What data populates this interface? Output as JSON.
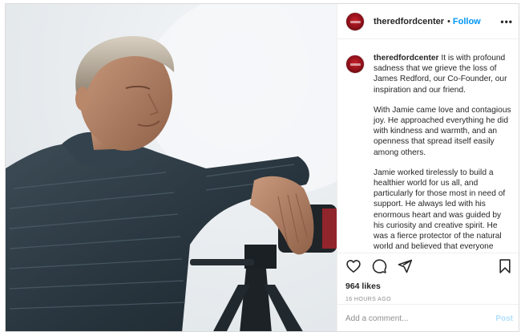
{
  "post": {
    "username": "theredfordcenter",
    "separator": "•",
    "follow_label": "Follow",
    "more_label": "•••",
    "caption": {
      "username": "theredfordcenter",
      "paragraphs": [
        "It is with profound sadness that we grieve the loss of James Redford, our Co-Founder, our inspiration and our friend.",
        "With Jamie came love and contagious joy. He approached everything he did with kindness and warmth, and an openness that spread itself easily among others.",
        "Jamie worked tirelessly to build a healthier world for us all, and particularly for those most in need of support. He always led with his enormous heart and was guided by his curiosity and creative spirit. He was a fierce protector of the natural world and believed that everyone deserved a healthy environment in which they"
      ]
    },
    "likes": "964 likes",
    "timestamp": "16 HOURS AGO",
    "comment": {
      "placeholder": "Add a comment...",
      "value": "",
      "post_label": "Post"
    },
    "icons": {
      "like": "heart-icon",
      "comment": "comment-icon",
      "share": "share-icon",
      "save": "bookmark-icon",
      "more": "more-options-icon"
    },
    "colors": {
      "link_blue": "#0095f6",
      "post_disabled": "#b2dffc",
      "muted": "#8e8e8e",
      "avatar_red": "#c8202b"
    }
  }
}
